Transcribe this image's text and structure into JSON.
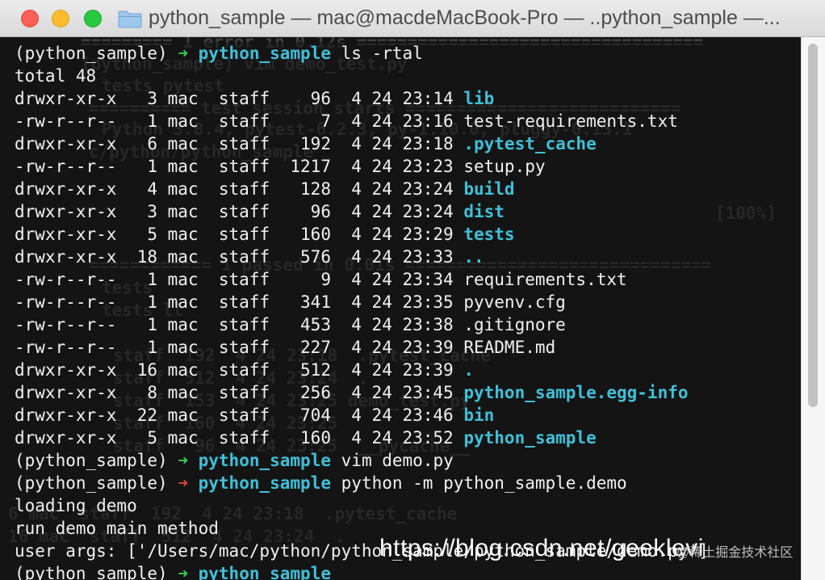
{
  "window": {
    "title": "python_sample — mac@macdeMacBook-Pro — ..python_sample —..."
  },
  "ghost_text": [
    {
      "text": "========= 1 error in 0.12s =================================="
    },
    {
      "text": "(python_sample) vim demo_test.py"
    },
    {
      "text": "tests pytest"
    },
    {
      "text": "========== test session starts ==========================="
    },
    {
      "text": "Python 3.8.4, pytest-6.2.3, py-1.10.0, pluggy-0.13.1"
    },
    {
      "text": "c/python/python_sample"
    },
    {
      "text": "[100%]"
    },
    {
      "text": "============ 1 passed in 0.01s =============================="
    },
    {
      "text": "tests"
    },
    {
      "text": "tests ll"
    },
    {
      "text": "staff  192  4 24 23:18  .pytest_cache"
    },
    {
      "text": "staff  512  4 24 23:24  ."
    },
    {
      "text": "staff  153  4 24 23:25 demo_test.py"
    },
    {
      "text": "staff  160  4 24 23:25"
    },
    {
      "text": "staff   96  4 24 23:25  __pycache__"
    },
    {
      "text": "6 mac  staff  192  4 24 23:18  .pytest_cache"
    },
    {
      "text": "16 mac  staff  512  4 24 23:24  ."
    }
  ],
  "terminal": {
    "prompt_env": "(python_sample)",
    "cwd": "python_sample",
    "arrow": "➜",
    "cmd1": "ls -rtal",
    "total": "total 48",
    "listing": [
      {
        "perms": "drwxr-xr-x",
        "links": "3",
        "user": "mac",
        "group": "staff",
        "size": "96",
        "month": "4",
        "day": "24",
        "time": "23:14",
        "name": "lib",
        "is_dir": true
      },
      {
        "perms": "-rw-r--r--",
        "links": "1",
        "user": "mac",
        "group": "staff",
        "size": "7",
        "month": "4",
        "day": "24",
        "time": "23:16",
        "name": "test-requirements.txt",
        "is_dir": false
      },
      {
        "perms": "drwxr-xr-x",
        "links": "6",
        "user": "mac",
        "group": "staff",
        "size": "192",
        "month": "4",
        "day": "24",
        "time": "23:18",
        "name": ".pytest_cache",
        "is_dir": true
      },
      {
        "perms": "-rw-r--r--",
        "links": "1",
        "user": "mac",
        "group": "staff",
        "size": "1217",
        "month": "4",
        "day": "24",
        "time": "23:23",
        "name": "setup.py",
        "is_dir": false
      },
      {
        "perms": "drwxr-xr-x",
        "links": "4",
        "user": "mac",
        "group": "staff",
        "size": "128",
        "month": "4",
        "day": "24",
        "time": "23:24",
        "name": "build",
        "is_dir": true
      },
      {
        "perms": "drwxr-xr-x",
        "links": "3",
        "user": "mac",
        "group": "staff",
        "size": "96",
        "month": "4",
        "day": "24",
        "time": "23:24",
        "name": "dist",
        "is_dir": true
      },
      {
        "perms": "drwxr-xr-x",
        "links": "5",
        "user": "mac",
        "group": "staff",
        "size": "160",
        "month": "4",
        "day": "24",
        "time": "23:29",
        "name": "tests",
        "is_dir": true
      },
      {
        "perms": "drwxr-xr-x",
        "links": "18",
        "user": "mac",
        "group": "staff",
        "size": "576",
        "month": "4",
        "day": "24",
        "time": "23:33",
        "name": "..",
        "is_dir": true
      },
      {
        "perms": "-rw-r--r--",
        "links": "1",
        "user": "mac",
        "group": "staff",
        "size": "9",
        "month": "4",
        "day": "24",
        "time": "23:34",
        "name": "requirements.txt",
        "is_dir": false
      },
      {
        "perms": "-rw-r--r--",
        "links": "1",
        "user": "mac",
        "group": "staff",
        "size": "341",
        "month": "4",
        "day": "24",
        "time": "23:35",
        "name": "pyvenv.cfg",
        "is_dir": false
      },
      {
        "perms": "-rw-r--r--",
        "links": "1",
        "user": "mac",
        "group": "staff",
        "size": "453",
        "month": "4",
        "day": "24",
        "time": "23:38",
        "name": ".gitignore",
        "is_dir": false
      },
      {
        "perms": "-rw-r--r--",
        "links": "1",
        "user": "mac",
        "group": "staff",
        "size": "227",
        "month": "4",
        "day": "24",
        "time": "23:39",
        "name": "README.md",
        "is_dir": false
      },
      {
        "perms": "drwxr-xr-x",
        "links": "16",
        "user": "mac",
        "group": "staff",
        "size": "512",
        "month": "4",
        "day": "24",
        "time": "23:39",
        "name": ".",
        "is_dir": true
      },
      {
        "perms": "drwxr-xr-x",
        "links": "8",
        "user": "mac",
        "group": "staff",
        "size": "256",
        "month": "4",
        "day": "24",
        "time": "23:45",
        "name": "python_sample.egg-info",
        "is_dir": true
      },
      {
        "perms": "drwxr-xr-x",
        "links": "22",
        "user": "mac",
        "group": "staff",
        "size": "704",
        "month": "4",
        "day": "24",
        "time": "23:46",
        "name": "bin",
        "is_dir": true
      },
      {
        "perms": "drwxr-xr-x",
        "links": "5",
        "user": "mac",
        "group": "staff",
        "size": "160",
        "month": "4",
        "day": "24",
        "time": "23:52",
        "name": "python_sample",
        "is_dir": true
      }
    ],
    "cmd2": "vim demo.py",
    "cmd3": "python -m python_sample.demo",
    "out1": "loading demo",
    "out2": "run demo main method",
    "out3": "user args: ['/Users/mac/python/python_sample/python_sample/demo.py']"
  },
  "watermark": {
    "url": "https://blog.csdn.net/geeklevi",
    "small": "@稀土掘金技术社区"
  },
  "colors": {
    "dir": "#40c0d8",
    "arrow_ok": "#36d05b",
    "arrow_err": "#e0443e",
    "text": "#f2f2f2",
    "background": "#141414"
  }
}
